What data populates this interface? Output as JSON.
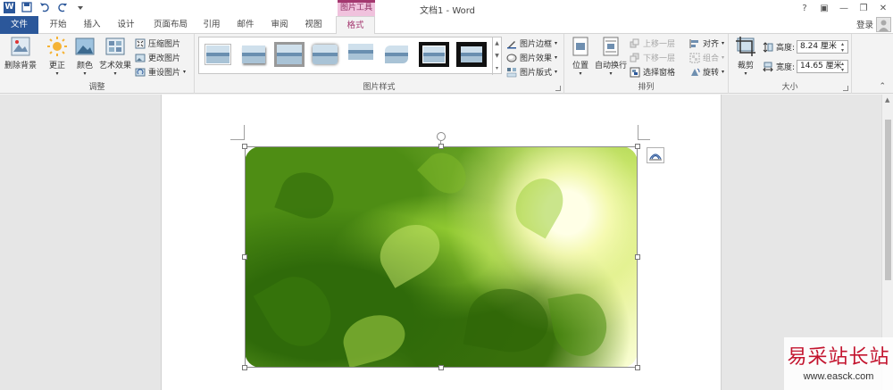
{
  "window": {
    "title": "文档1 - Word",
    "context_tab_title": "图片工具",
    "controls": [
      "?",
      "▣",
      "—",
      "❐",
      "✕"
    ]
  },
  "quick_access": {
    "app_logo_letter": "W"
  },
  "tabs": [
    {
      "label": "文件"
    },
    {
      "label": "开始"
    },
    {
      "label": "插入"
    },
    {
      "label": "设计"
    },
    {
      "label": "页面布局"
    },
    {
      "label": "引用"
    },
    {
      "label": "邮件"
    },
    {
      "label": "审阅"
    },
    {
      "label": "视图"
    },
    {
      "label": "格式"
    }
  ],
  "signin": "登录",
  "ribbon": {
    "adjust": {
      "label": "调整",
      "remove_bg": "删除背景",
      "corrections": "更正",
      "color": "颜色",
      "artistic": "艺术效果",
      "compress": "压缩图片",
      "change": "更改图片",
      "reset": "重设图片"
    },
    "styles": {
      "label": "图片样式",
      "border": "图片边框",
      "effects": "图片效果",
      "layout": "图片版式"
    },
    "arrange": {
      "label": "排列",
      "position": "位置",
      "wrap": "自动换行",
      "forward": "上移一层",
      "backward": "下移一层",
      "selection_pane": "选择窗格",
      "align": "对齐",
      "group": "组合",
      "rotate": "旋转"
    },
    "size": {
      "label": "大小",
      "crop": "裁剪",
      "height_label": "高度:",
      "height_value": "8.24 厘米",
      "width_label": "宽度:",
      "width_value": "14.65 厘米"
    }
  },
  "watermark": {
    "title": "易采站长站",
    "url": "www.easck.com"
  },
  "colors": {
    "file_tab": "#2b579a",
    "context_accent": "#a4376f",
    "watermark_red": "#c3142e"
  }
}
